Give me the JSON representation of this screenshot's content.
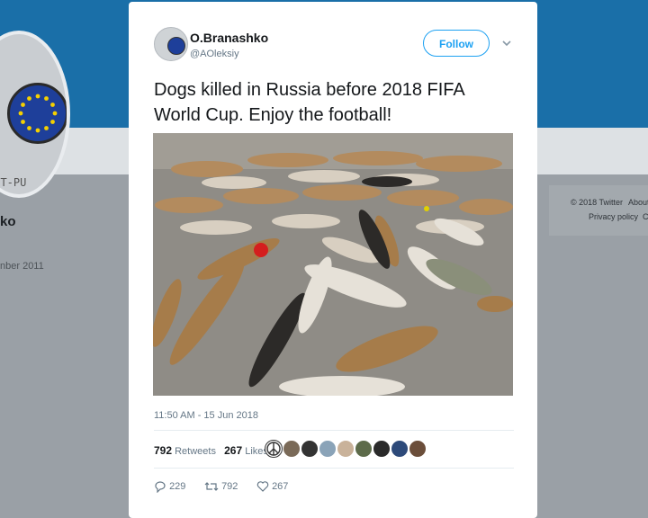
{
  "profile_background": {
    "name_fragment": "ko",
    "joined_fragment": "nber 2011",
    "avatar_text": "igT-PU",
    "footer": {
      "copyright": "© 2018 Twitter",
      "about": "About",
      "privacy": "Privacy policy",
      "cookies": "C"
    }
  },
  "tweet": {
    "author_name": "O.Branashko",
    "author_handle": "@AOleksiy",
    "follow_label": "Follow",
    "text": "Dogs killed in Russia before 2018 FIFA World Cup. Enjoy the football!",
    "timestamp": "11:50 AM - 15 Jun 2018",
    "retweets_count": "792",
    "retweets_label": "Retweets",
    "likes_count": "267",
    "likes_label": "Likes",
    "replies": "229",
    "retweets_action": "792",
    "likes_action": "267"
  },
  "colors": {
    "banner": "#1a6fa8",
    "twitter_blue": "#1da1f2",
    "muted_text": "#657786"
  }
}
